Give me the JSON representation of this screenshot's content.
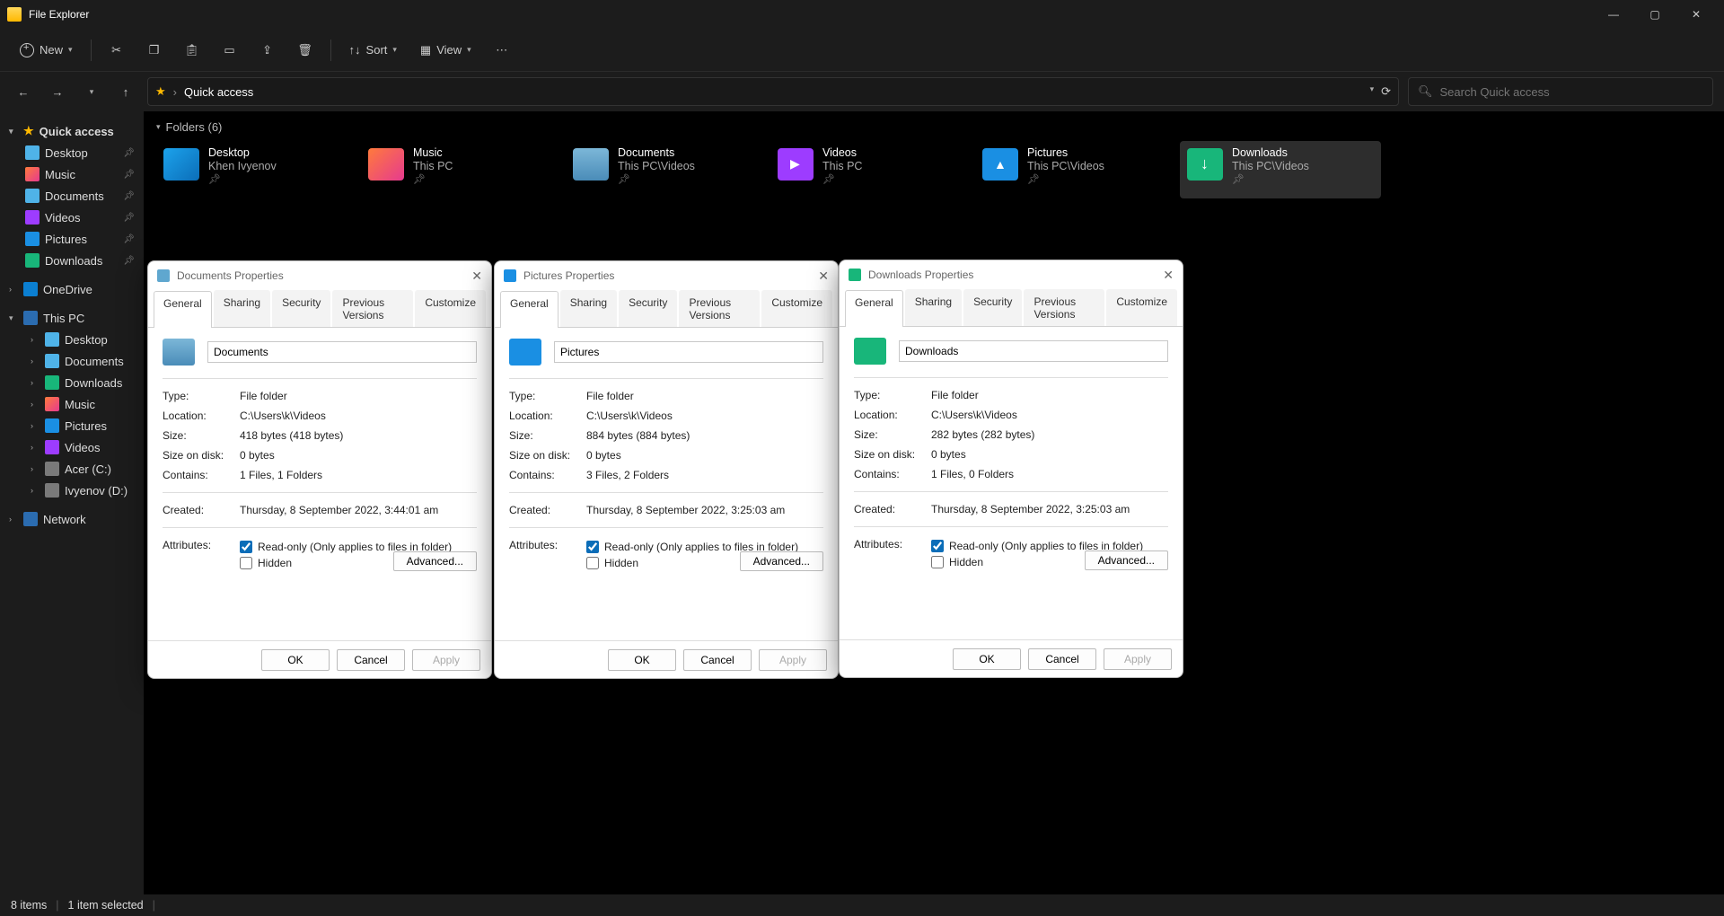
{
  "app": {
    "title": "File Explorer"
  },
  "toolbar": {
    "new": "New",
    "sort": "Sort",
    "view": "View"
  },
  "address": {
    "path": "Quick access",
    "search_placeholder": "Search Quick access"
  },
  "nav": {
    "quick": "Quick access",
    "desktop": "Desktop",
    "music": "Music",
    "documents": "Documents",
    "videos": "Videos",
    "pictures": "Pictures",
    "downloads": "Downloads",
    "onedrive": "OneDrive",
    "thispc": "This PC",
    "pc_desktop": "Desktop",
    "pc_documents": "Documents",
    "pc_downloads": "Downloads",
    "pc_music": "Music",
    "pc_pictures": "Pictures",
    "pc_videos": "Videos",
    "drive_c": "Acer (C:)",
    "drive_d": "Ivyenov (D:)",
    "network": "Network"
  },
  "group": {
    "header": "Folders (6)"
  },
  "folders": [
    {
      "name": "Desktop",
      "sub": "Khen Ivyenov"
    },
    {
      "name": "Music",
      "sub": "This PC"
    },
    {
      "name": "Documents",
      "sub": "This PC\\Videos"
    },
    {
      "name": "Videos",
      "sub": "This PC"
    },
    {
      "name": "Pictures",
      "sub": "This PC\\Videos"
    },
    {
      "name": "Downloads",
      "sub": "This PC\\Videos"
    }
  ],
  "status": {
    "items": "8 items",
    "selected": "1 item selected"
  },
  "tabs": {
    "general": "General",
    "sharing": "Sharing",
    "security": "Security",
    "prev": "Previous Versions",
    "customize": "Customize"
  },
  "labels": {
    "type": "Type:",
    "location": "Location:",
    "size": "Size:",
    "sizeondisk": "Size on disk:",
    "contains": "Contains:",
    "created": "Created:",
    "attributes": "Attributes:",
    "readonly": "Read-only (Only applies to files in folder)",
    "hidden": "Hidden",
    "advanced": "Advanced...",
    "ok": "OK",
    "cancel": "Cancel",
    "apply": "Apply"
  },
  "dlg1": {
    "title": "Documents Properties",
    "name": "Documents",
    "type": "File folder",
    "location": "C:\\Users\\k\\Videos",
    "size": "418 bytes (418 bytes)",
    "sizeondisk": "0 bytes",
    "contains": "1 Files, 1 Folders",
    "created": "Thursday, 8 September 2022, 3:44:01 am"
  },
  "dlg2": {
    "title": "Pictures Properties",
    "name": "Pictures",
    "type": "File folder",
    "location": "C:\\Users\\k\\Videos",
    "size": "884 bytes (884 bytes)",
    "sizeondisk": "0 bytes",
    "contains": "3 Files, 2 Folders",
    "created": "Thursday, 8 September 2022, 3:25:03 am"
  },
  "dlg3": {
    "title": "Downloads Properties",
    "name": "Downloads",
    "type": "File folder",
    "location": "C:\\Users\\k\\Videos",
    "size": "282 bytes (282 bytes)",
    "sizeondisk": "0 bytes",
    "contains": "1 Files, 0 Folders",
    "created": "Thursday, 8 September 2022, 3:25:03 am"
  }
}
